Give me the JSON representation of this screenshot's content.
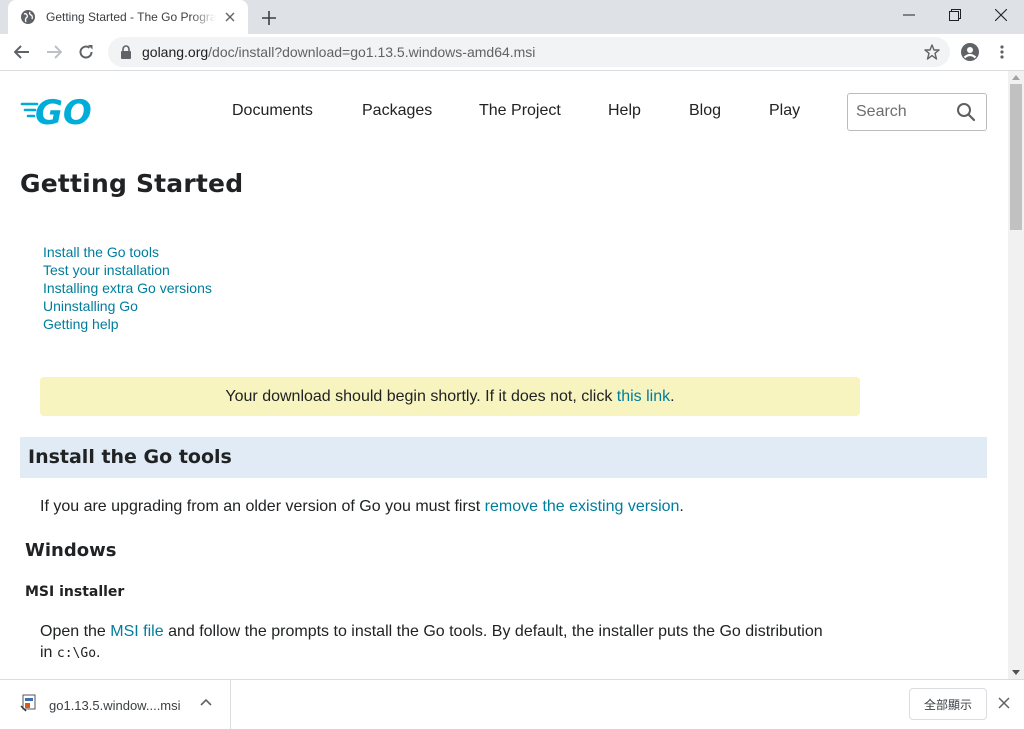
{
  "browser": {
    "tab_title": "Getting Started - The Go Programming Language",
    "url_host": "golang.org",
    "url_path": "/doc/install?download=go1.13.5.windows-amd64.msi"
  },
  "site": {
    "logo_text": "GO",
    "nav": [
      "Documents",
      "Packages",
      "The Project",
      "Help",
      "Blog",
      "Play"
    ],
    "search_placeholder": "Search"
  },
  "page": {
    "title": "Getting Started",
    "toc": [
      "Install the Go tools",
      "Test your installation",
      "Installing extra Go versions",
      "Uninstalling Go",
      "Getting help"
    ],
    "notice": {
      "text": "Your download should begin shortly. If it does not, click ",
      "link": "this link",
      "suffix": "."
    },
    "section_title": "Install the Go tools",
    "upgrade": {
      "text": "If you are upgrading from an older version of Go you must first ",
      "link": "remove the existing version",
      "suffix": "."
    },
    "windows_heading": "Windows",
    "msi_heading": "MSI installer",
    "msi": {
      "prefix": "Open the ",
      "link": "MSI file",
      "text": " and follow the prompts to install the Go tools. By default, the installer puts the Go distribution",
      "line2_prefix": "in ",
      "code": "c:\\Go",
      "line2_suffix": "."
    }
  },
  "downloads": {
    "file_name": "go1.13.5.window....msi",
    "show_all": "全部顯示"
  },
  "colors": {
    "link": "#007d9c",
    "go_blue": "#00add8",
    "notice_bg": "#f7f4c0",
    "section_bg": "#e0ebf5"
  }
}
